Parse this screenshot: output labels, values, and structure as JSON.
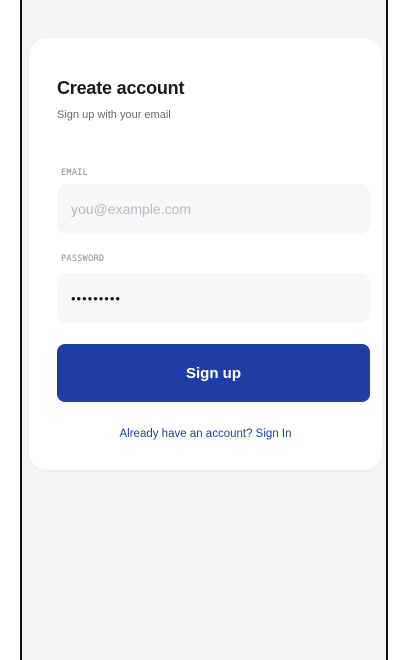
{
  "form": {
    "title": "Create account",
    "subtitle": "Sign up with your email",
    "email_label": "EMAIL",
    "email_placeholder": "you@example.com",
    "password_label": "PASSWORD",
    "password_value": "•••••••••",
    "submit_label": "Sign up",
    "signin_link": "Already have an account? Sign In"
  },
  "colors": {
    "primary": "#1f3fa6",
    "background": "#f4f4f6",
    "card": "#ffffff",
    "input": "#f7f7f9"
  }
}
